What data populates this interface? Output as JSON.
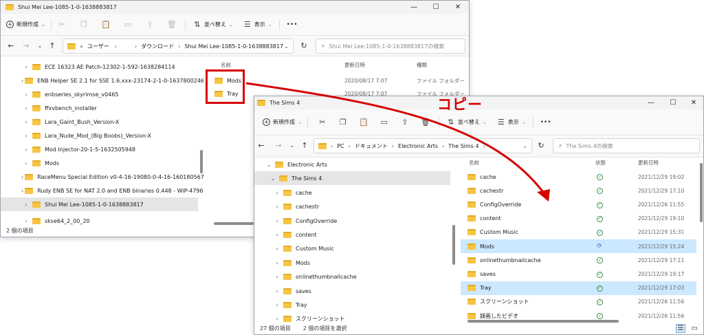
{
  "annotation": {
    "copy_label": "コピー",
    "arrow_color": "#d40000"
  },
  "window1": {
    "title": "Shui Mei Lee-1085-1-0-1638883817",
    "toolbar": {
      "new_label": "新規作成",
      "sort_label": "並べ替え",
      "view_label": "表示",
      "more_label": "•••"
    },
    "address": {
      "crumbs": [
        "«",
        "ユーザー",
        "›",
        "›",
        "ダウンロード",
        "›",
        "Shui Mei Lee-1085-1-0-1638883817"
      ]
    },
    "search_placeholder": "Shui Mei Lee-1085-1-0-1638883817の検索",
    "tree": [
      {
        "label": "ECE 16323 AE Patch-12302-1-592-1638284114"
      },
      {
        "label": "ENB Helper SE 2.1 for SSE 1.6.xxx-23174-2-1-0-1637800246"
      },
      {
        "label": "enbseries_skyrimse_v0465"
      },
      {
        "label": "ffxvbench_installer"
      },
      {
        "label": "Lara_Gaint_Bush_Version-X"
      },
      {
        "label": "Lara_Nude_Mod_(Big Boobs)_Version-X"
      },
      {
        "label": "Mod Injector-20-1-5-1632505948"
      },
      {
        "label": "Mods"
      },
      {
        "label": "RaceMenu Special Edition v0-4-16-19080-0-4-16-1601805673"
      },
      {
        "label": "Rudy ENB SE for NAT 2.0 and ENB binaries 0.448 - WiP-4796-5-0f-1"
      },
      {
        "label": "Shui Mei Lee-1085-1-0-1638883817"
      },
      {
        "label": "skse64_2_00_20"
      }
    ],
    "columns": {
      "name": "名前",
      "date": "更新日時",
      "type": "種類"
    },
    "files": [
      {
        "name": "Mods",
        "date": "2020/08/17 7:07",
        "type": "ファイル フォルダー"
      },
      {
        "name": "Tray",
        "date": "2020/08/17 7:07",
        "type": "ファイル フォルダー"
      }
    ],
    "status": "2 個の項目"
  },
  "window2": {
    "title": "The Sims 4",
    "toolbar": {
      "new_label": "新規作成",
      "sort_label": "並べ替え",
      "view_label": "表示",
      "more_label": "•••"
    },
    "address": {
      "crumbs": [
        "›",
        "PC",
        "›",
        "ドキュメント",
        "›",
        "Electronic Arts",
        "›",
        "The Sims 4",
        "›"
      ]
    },
    "search_placeholder": "The Sims 4の検索",
    "tree": [
      {
        "label": "Electronic Arts"
      },
      {
        "label": "The Sims 4"
      },
      {
        "label": "cache"
      },
      {
        "label": "cachestr"
      },
      {
        "label": "ConfigOverride"
      },
      {
        "label": "content"
      },
      {
        "label": "Custom Music"
      },
      {
        "label": "Mods"
      },
      {
        "label": "onlinethumbnailcache"
      },
      {
        "label": "saves"
      },
      {
        "label": "Tray"
      },
      {
        "label": "スクリーンショット"
      }
    ],
    "columns": {
      "name": "名前",
      "status": "状態",
      "date": "更新日時"
    },
    "files": [
      {
        "name": "cache",
        "date": "2021/12/29 19:02"
      },
      {
        "name": "cachestr",
        "date": "2021/12/29 17:10"
      },
      {
        "name": "ConfigOverride",
        "date": "2021/12/26 11:55"
      },
      {
        "name": "content",
        "date": "2021/12/29 19:10"
      },
      {
        "name": "Custom Music",
        "date": "2021/12/29 15:31"
      },
      {
        "name": "Mods",
        "date": "2021/12/29 15:24"
      },
      {
        "name": "onlinethumbnailcache",
        "date": "2021/12/29 17:11"
      },
      {
        "name": "saves",
        "date": "2021/12/29 19:17"
      },
      {
        "name": "Tray",
        "date": "2021/12/29 17:03"
      },
      {
        "name": "スクリーンショット",
        "date": "2021/12/26 11:56"
      },
      {
        "name": "録画したビデオ",
        "date": "2021/12/26 11:56"
      }
    ],
    "status": {
      "count": "27 個の項目",
      "selected": "2 個の項目を選択"
    }
  }
}
